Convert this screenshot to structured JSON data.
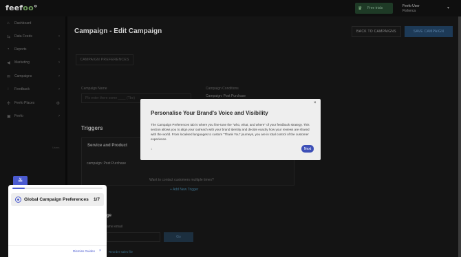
{
  "brand": {
    "logo_text": "feef",
    "logo_oo": "o",
    "logo_suffix": "°"
  },
  "topbar": {
    "trial_label": "Free trials",
    "user_name": "Feefo User",
    "user_role": "Fisherca"
  },
  "sidebar": {
    "items": [
      {
        "label": "Dashboard",
        "icon": "home-icon"
      },
      {
        "label": "Data Feeds",
        "icon": "feed-icon"
      },
      {
        "label": "Reports",
        "icon": "chart-icon"
      },
      {
        "label": "Marketing",
        "icon": "megaphone-icon"
      },
      {
        "label": "Campaigns",
        "icon": "mail-icon"
      },
      {
        "label": "Feedback",
        "icon": "comment-icon"
      },
      {
        "label": "Feefo Places",
        "icon": "pin-icon"
      },
      {
        "label": "Feefo",
        "icon": "feefo-icon"
      }
    ],
    "small_text": "Users"
  },
  "main": {
    "title": "Campaign - Edit Campaign",
    "back_label": "BACK TO CAMPAIGNS",
    "save_label": "SAVE CAMPAIGN",
    "tab_label": "CAMPAIGN PREFERENCES",
    "campaign_name_label": "Campaign Name",
    "campaign_name_placeholder": "Pls enter there some ____ (Tbe)",
    "campaign_conditions_label": "Campaign Conditions",
    "campaign_conditions_value": "Campaign: Post Purchase",
    "triggers_heading": "Triggers",
    "service_product_heading": "Service and Product",
    "service_product_value": "campaign: Post Purchase",
    "multiple_times_text": "Want to contact customers multiple times?",
    "add_trigger_label": "+ Add New Trigger",
    "lower_heading": "ge",
    "lower_label": "ame email",
    "go_label": "Go"
  },
  "modal": {
    "title": "Personalise Your Brand's Voice and Visibility",
    "body": "The Campaign Preferences tab is where you fine-tune the \"who, what, and where\" of your feedback strategy. This section allows you to align your outreach with your brand identity and decide exactly how your reviews are shared with the world. From localised languages to custom \"Thank You\" journeys, you are in total control of the customer experience.",
    "progress": "1",
    "next_label": "Next",
    "close_label": "×"
  },
  "guide": {
    "toggle_icon": "chevrons-down-icon",
    "progress_fraction": 0.14,
    "item_label": "Global Campaign Preferences",
    "item_count": "1/7",
    "dismiss_label": "Dismiss Guides",
    "dismiss_x": "×"
  },
  "below_guide_text": "Reorder sales file"
}
